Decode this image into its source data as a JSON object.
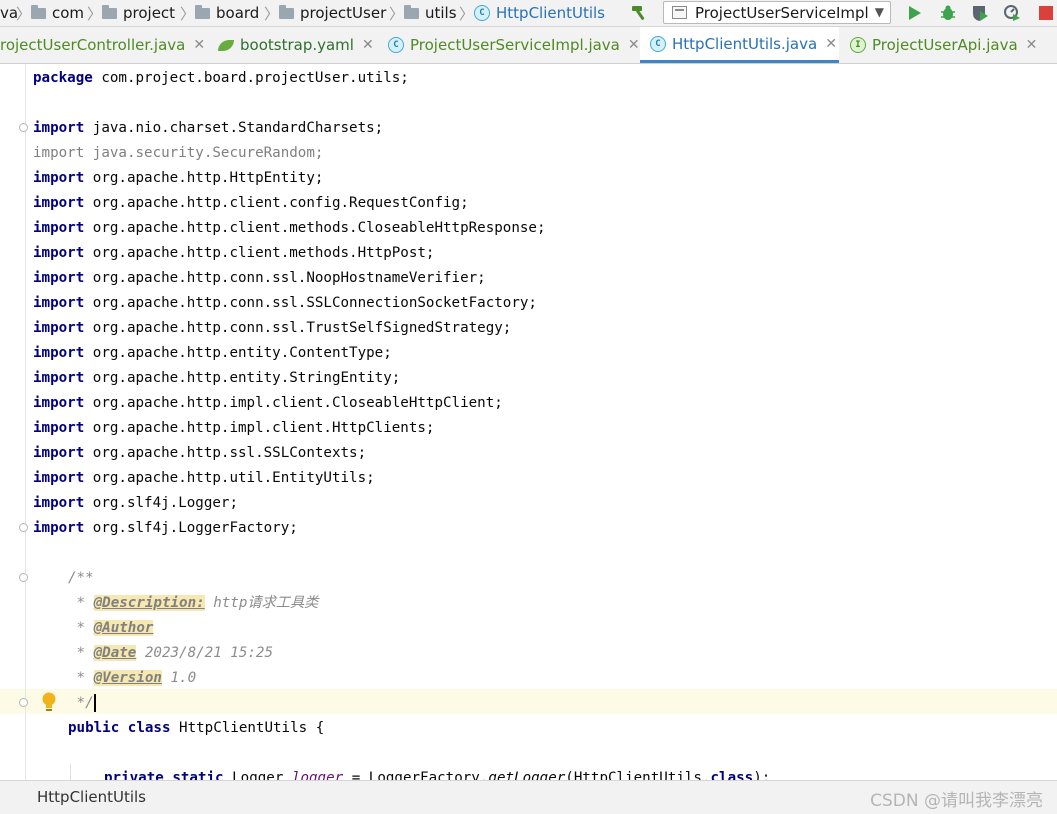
{
  "breadcrumbs": [
    "va",
    "com",
    "project",
    "board",
    "projectUser",
    "utils",
    "HttpClientUtils"
  ],
  "toolbar": {
    "run_config": "ProjectUserServiceImpl",
    "colors": {
      "run": "#3fa34d",
      "debug": "#3fa34d",
      "stop": "#d9413a",
      "build": "#4b8a2c"
    }
  },
  "tabs": [
    {
      "label": "rojectUserController.java",
      "icon": "class-icon",
      "active": false
    },
    {
      "label": "bootstrap.yaml",
      "icon": "spring-leaf-icon",
      "active": false
    },
    {
      "label": "ProjectUserServiceImpl.java",
      "icon": "class-icon",
      "active": false
    },
    {
      "label": "HttpClientUtils.java",
      "icon": "class-icon",
      "active": true
    },
    {
      "label": "ProjectUserApi.java",
      "icon": "interface-icon",
      "active": false
    }
  ],
  "code": {
    "package_kw": "package",
    "package_name": " com.project.board.projectUser.utils;",
    "import_kw": "import",
    "imports": [
      " java.nio.charset.StandardCharsets;",
      " java.security.SecureRandom;",
      " org.apache.http.HttpEntity;",
      " org.apache.http.client.config.RequestConfig;",
      " org.apache.http.client.methods.CloseableHttpResponse;",
      " org.apache.http.client.methods.HttpPost;",
      " org.apache.http.conn.ssl.NoopHostnameVerifier;",
      " org.apache.http.conn.ssl.SSLConnectionSocketFactory;",
      " org.apache.http.conn.ssl.TrustSelfSignedStrategy;",
      " org.apache.http.entity.ContentType;",
      " org.apache.http.entity.StringEntity;",
      " org.apache.http.impl.client.CloseableHttpClient;",
      " org.apache.http.impl.client.HttpClients;",
      " org.apache.http.ssl.SSLContexts;",
      " org.apache.http.util.EntityUtils;",
      " org.slf4j.Logger;",
      " org.slf4j.LoggerFactory;"
    ],
    "doc_open": "/**",
    "doc_star": " * ",
    "doc_desc_tag": "@Description:",
    "doc_desc_text": " http请求工具类",
    "doc_author_tag": "@Author",
    "doc_date_tag": "@Date",
    "doc_date_text": " 2023/8/21 15:25",
    "doc_version_tag": "@Version",
    "doc_version_text": " 1.0",
    "doc_close": " */",
    "class_kw_public": "public",
    "class_kw_class": "class",
    "class_name": " HttpClientUtils {",
    "field_kw_private": "private",
    "field_kw_static": "static",
    "field_type": " Logger ",
    "field_name": "logger",
    "field_assign": " = LoggerFactory.",
    "field_method": "getLogger",
    "field_arg": "(HttpClientUtils.",
    "field_class_kw": "class",
    "field_end": ");"
  },
  "status": {
    "breadcrumb": "HttpClientUtils",
    "watermark": "CSDN @请叫我李漂亮"
  }
}
